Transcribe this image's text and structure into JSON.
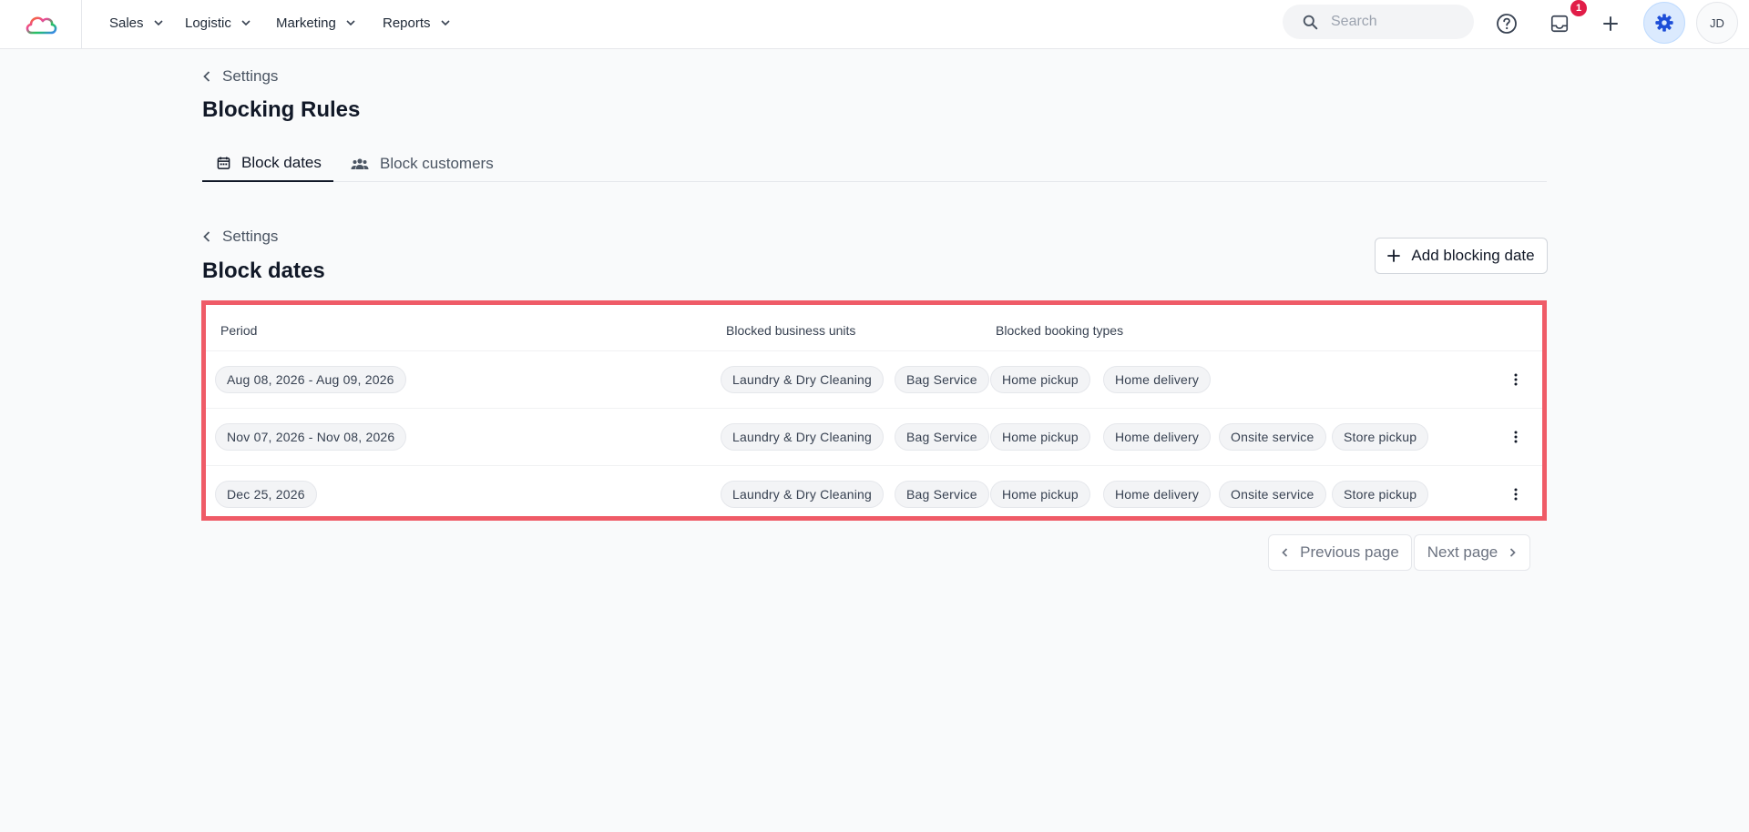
{
  "nav": {
    "items": [
      {
        "label": "Sales"
      },
      {
        "label": "Logistic"
      },
      {
        "label": "Marketing"
      },
      {
        "label": "Reports"
      }
    ],
    "search_placeholder": "Search",
    "notifications_count": "1",
    "avatar_initials": "JD"
  },
  "page": {
    "breadcrumb": "Settings",
    "title": "Blocking Rules",
    "tabs": [
      {
        "label": "Block dates",
        "icon": "calendar-icon",
        "active": true
      },
      {
        "label": "Block customers",
        "icon": "users-icon",
        "active": false
      }
    ]
  },
  "section": {
    "breadcrumb": "Settings",
    "title": "Block dates",
    "add_button": "Add blocking date"
  },
  "table": {
    "columns": [
      "Period",
      "Blocked business units",
      "Blocked booking types"
    ],
    "rows": [
      {
        "period": "Aug 08, 2026 - Aug 09, 2026",
        "units": [
          "Laundry & Dry Cleaning",
          "Bag Service"
        ],
        "types": [
          "Home pickup",
          "Home delivery"
        ]
      },
      {
        "period": "Nov 07, 2026 - Nov 08, 2026",
        "units": [
          "Laundry & Dry Cleaning",
          "Bag Service"
        ],
        "types": [
          "Home pickup",
          "Home delivery",
          "Onsite service",
          "Store pickup"
        ]
      },
      {
        "period": "Dec 25, 2026",
        "units": [
          "Laundry & Dry Cleaning",
          "Bag Service"
        ],
        "types": [
          "Home pickup",
          "Home delivery",
          "Onsite service",
          "Store pickup"
        ]
      }
    ]
  },
  "pagination": {
    "previous": "Previous page",
    "next": "Next page"
  },
  "colors": {
    "highlight_border": "#ef5b67",
    "notification_badge": "#e11d48",
    "settings_active_bg": "#dbeafe",
    "settings_icon": "#1d4ed8"
  }
}
